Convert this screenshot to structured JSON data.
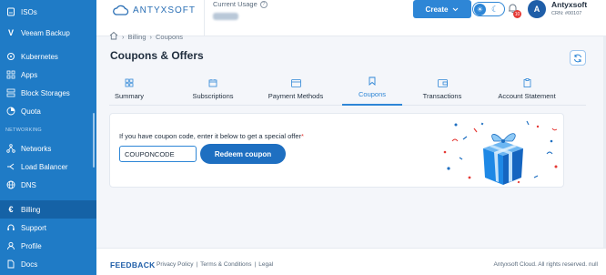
{
  "sidebar": {
    "items_top": [
      {
        "label": "ISOs",
        "icon": "iso-icon"
      },
      {
        "label": "Veeam Backup",
        "icon": "veeam-icon"
      }
    ],
    "items_mid": [
      {
        "label": "Kubernetes",
        "icon": "kubernetes-icon"
      },
      {
        "label": "Apps",
        "icon": "apps-icon"
      },
      {
        "label": "Block Storages",
        "icon": "block-storage-icon"
      },
      {
        "label": "Quota",
        "icon": "quota-icon"
      }
    ],
    "section_networking": "NETWORKING",
    "items_net": [
      {
        "label": "Networks",
        "icon": "networks-icon"
      },
      {
        "label": "Load Balancer",
        "icon": "load-balancer-icon"
      },
      {
        "label": "DNS",
        "icon": "dns-icon"
      }
    ],
    "items_bottom": [
      {
        "label": "Billing",
        "icon": "billing-icon",
        "active": true
      },
      {
        "label": "Support",
        "icon": "support-icon"
      },
      {
        "label": "Profile",
        "icon": "profile-icon"
      },
      {
        "label": "Docs",
        "icon": "docs-icon"
      }
    ]
  },
  "header": {
    "logo_text": "ANTYXSOFT",
    "usage_label": "Current Usage",
    "create_label": "Create",
    "notifications_count": "10",
    "avatar_letter": "A",
    "account_name": "Antyxsoft",
    "account_crn": "CRN: #00107"
  },
  "main": {
    "breadcrumb": [
      "Billing",
      "Coupons"
    ],
    "page_title": "Coupons & Offers",
    "tabs": [
      {
        "label": "Summary",
        "icon": "summary-icon"
      },
      {
        "label": "Subscriptions",
        "icon": "calendar-icon"
      },
      {
        "label": "Payment Methods",
        "icon": "credit-card-icon"
      },
      {
        "label": "Coupons",
        "icon": "bookmark-icon",
        "active": true
      },
      {
        "label": "Transactions",
        "icon": "wallet-icon"
      },
      {
        "label": "Account Statement",
        "icon": "clipboard-icon"
      }
    ],
    "coupon_prompt": "If you have coupon code, enter it below to get a special offer",
    "coupon_required_mark": "*",
    "coupon_value": "COUPONCODE",
    "redeem_label": "Redeem coupon"
  },
  "footer": {
    "feedback": "FEEDBACK",
    "privacy": "Privacy Policy",
    "sep": "|",
    "terms": "Terms & Conditions",
    "legal": "Legal",
    "copyright": "Antyxsoft Cloud. All rights reserved. null"
  },
  "colors": {
    "sidebar": "#1f7bc6",
    "accent": "#2e86d6",
    "badge": "#e53935"
  }
}
